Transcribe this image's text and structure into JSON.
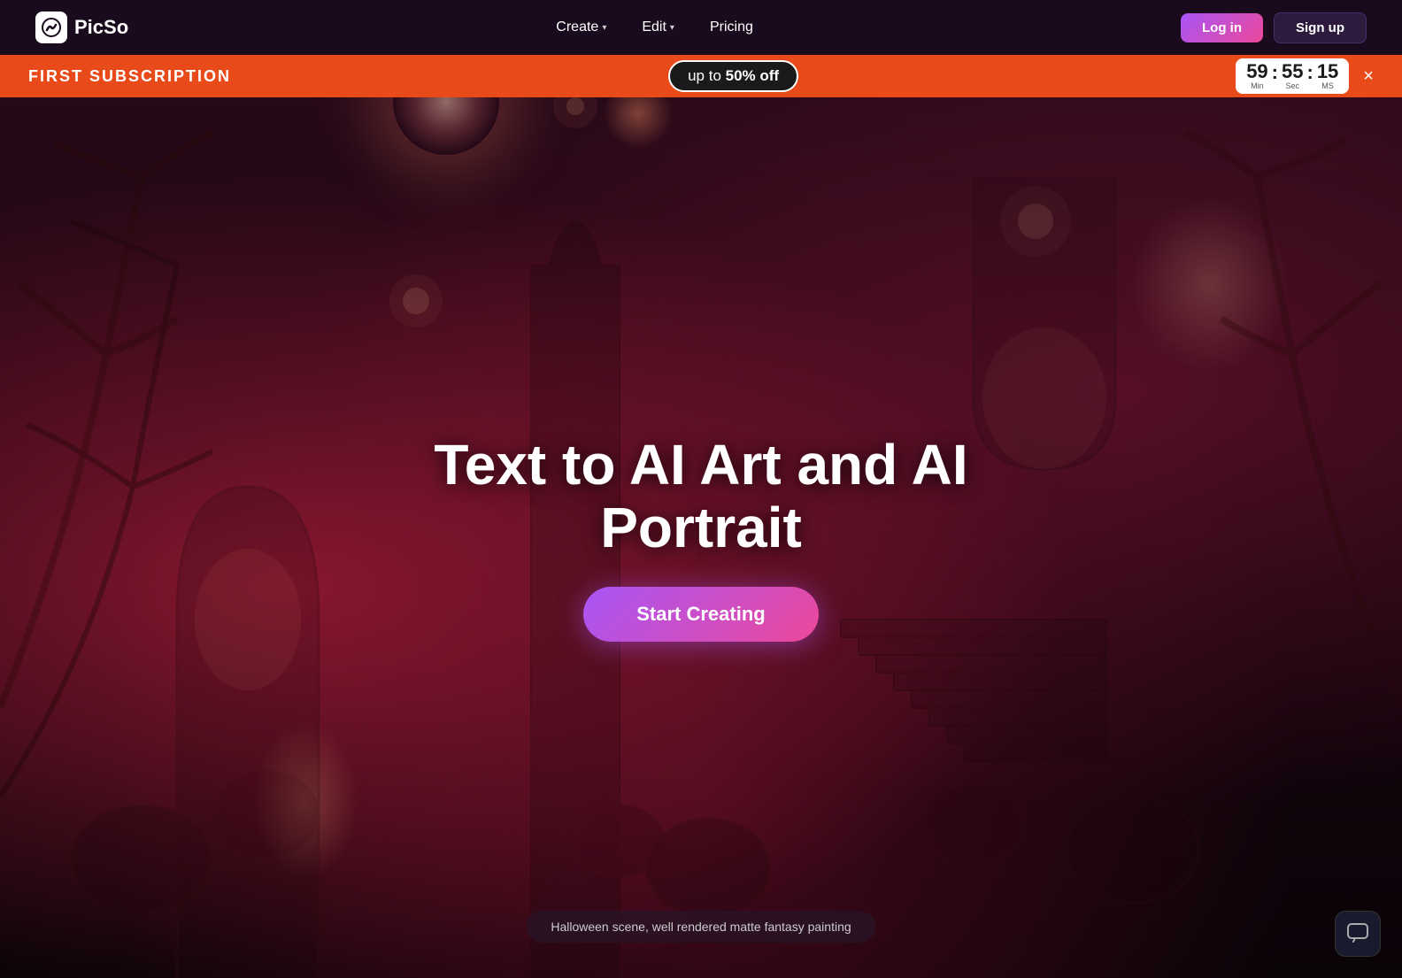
{
  "navbar": {
    "logo_icon": "🎨",
    "logo_text": "PicSo",
    "nav_items": [
      {
        "label": "Create",
        "has_chevron": true
      },
      {
        "label": "Edit",
        "has_chevron": true
      },
      {
        "label": "Pricing",
        "has_chevron": false
      }
    ],
    "login_label": "Log in",
    "signup_label": "Sign up"
  },
  "promo_banner": {
    "text": "FIRST SUBSCRIPTION",
    "badge_prefix": "up to",
    "badge_value": "50% off",
    "timer": {
      "min": "59",
      "sec": "55",
      "ms": "15",
      "min_label": "Min",
      "sec_label": "Sec",
      "ms_label": "MS"
    },
    "close_label": "×"
  },
  "hero": {
    "title": "Text to AI Art and AI Portrait",
    "start_button": "Start Creating",
    "caption": "Halloween scene, well rendered matte fantasy painting"
  },
  "chat_icon": "💬"
}
